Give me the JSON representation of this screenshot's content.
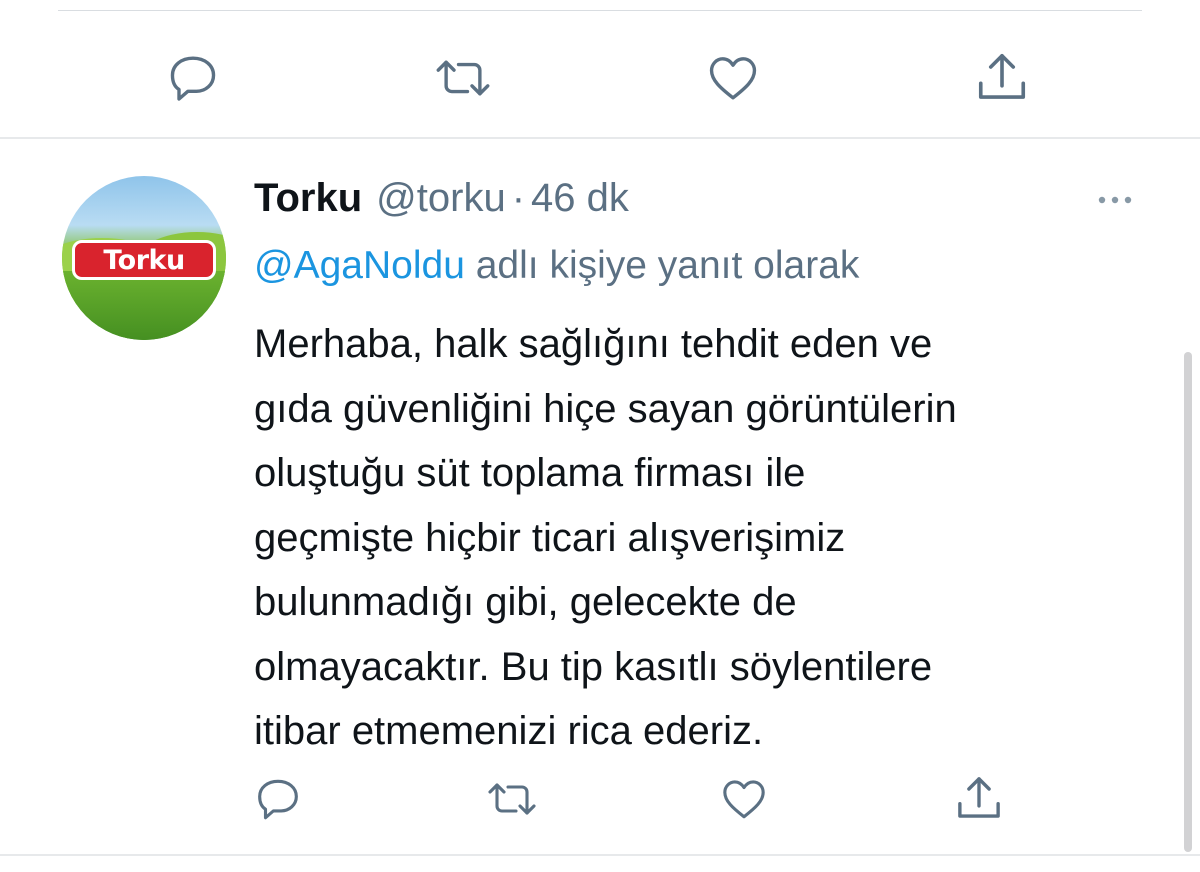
{
  "previous_tweet_actions": {
    "reply": "reply-icon",
    "retweet": "retweet-icon",
    "like": "like-icon",
    "share": "share-icon"
  },
  "tweet": {
    "display_name": "Torku",
    "handle": "@torku",
    "separator": "·",
    "time": "46 dk",
    "avatar_logo_text": "Torku",
    "reply_to_mention": "@AgaNoldu",
    "reply_to_suffix": " adlı kişiye yanıt olarak",
    "text": "Merhaba, halk sağlığını tehdit eden ve\ngıda güvenliğini hiçe sayan görüntülerin\noluştuğu süt toplama firması ile\ngeçmişte hiçbir ticari alışverişimiz\nbulunmadığı gibi, gelecekte de\nolmayacaktır. Bu tip kasıtlı söylentilere\nitibar etmemenizi rica ederiz.",
    "more_icon": "more-icon",
    "actions": {
      "reply": "reply-icon",
      "retweet": "retweet-icon",
      "like": "like-icon",
      "share": "share-icon"
    }
  },
  "colors": {
    "icon_gray": "#5b7083",
    "link_blue": "#1b95e0",
    "text": "#0f1419",
    "brand_red": "#d9232d"
  }
}
